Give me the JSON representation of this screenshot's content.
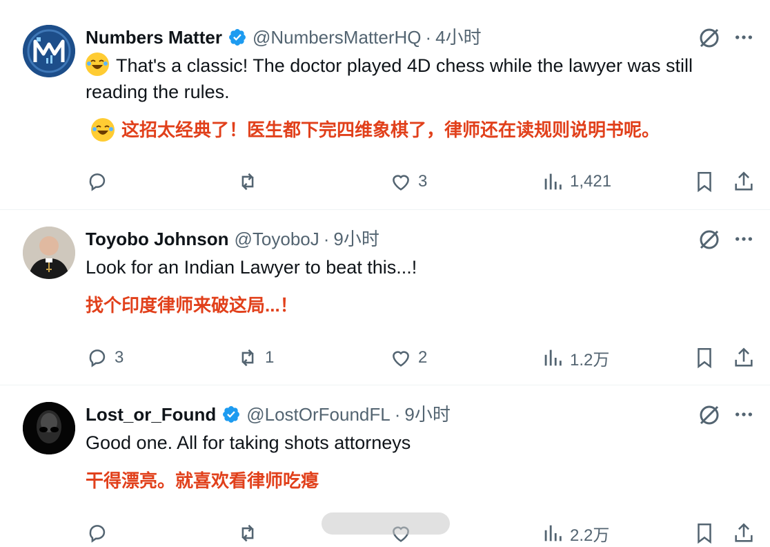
{
  "tweets": [
    {
      "name": "Numbers Matter",
      "verified": true,
      "handle": "@NumbersMatterHQ",
      "separator": "·",
      "time": "4小时",
      "text": "That's a classic! The doctor played 4D chess while the lawyer was still reading the rules.",
      "translation": "这招太经典了！医生都下完四维象棋了，律师还在读规则说明书呢。",
      "replies": "",
      "retweets": "",
      "likes": "3",
      "views": "1,421"
    },
    {
      "name": "Toyobo Johnson",
      "verified": false,
      "handle": "@ToyoboJ",
      "separator": "·",
      "time": "9小时",
      "text": "Look for an Indian Lawyer to beat this...!",
      "translation": "找个印度律师来破这局...！",
      "replies": "3",
      "retweets": "1",
      "likes": "2",
      "views": "1.2万"
    },
    {
      "name": "Lost_or_Found",
      "verified": true,
      "handle": "@LostOrFoundFL",
      "separator": "·",
      "time": "9小时",
      "text": "Good one. All for taking shots attorneys",
      "translation": "干得漂亮。就喜欢看律师吃瘪",
      "replies": "",
      "retweets": "",
      "likes": "",
      "views": "2.2万"
    }
  ],
  "colors": {
    "accent": "#1d9bf0",
    "muted": "#536471",
    "translation": "#e1401b",
    "text": "#0f1419"
  },
  "icons": [
    "reply-icon",
    "retweet-icon",
    "like-icon",
    "views-icon",
    "bookmark-icon",
    "share-icon",
    "grok-icon",
    "more-icon",
    "verified-badge-icon",
    "laughing-emoji-icon"
  ]
}
